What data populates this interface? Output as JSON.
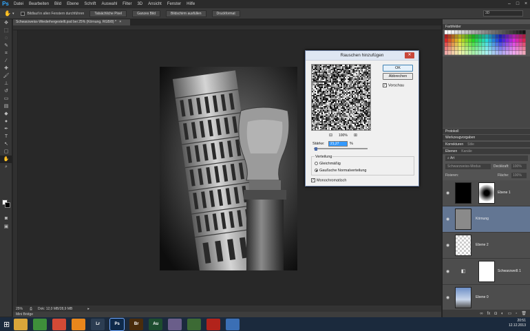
{
  "app": {
    "logo": "Ps"
  },
  "menu": [
    "Datei",
    "Bearbeiten",
    "Bild",
    "Ebene",
    "Schrift",
    "Auswahl",
    "Filter",
    "3D",
    "Ansicht",
    "Fenster",
    "Hilfe"
  ],
  "window_controls": [
    "–",
    "□",
    "×"
  ],
  "options_bar": {
    "scroll_all_label": "Bildlauf in allen Fenstern durchführen",
    "buttons": [
      "Tatsächliche Pixel",
      "Ganzes Bild",
      "Bildschirm ausfüllen",
      "Druckformat"
    ],
    "workspace": "3D"
  },
  "document": {
    "tab_title": "Schwarzweiss-Wiederhergestellt.psd bei 25% (Körnung, RGB/8) *",
    "zoom": "25%",
    "doc_size": "Dok: 12,0 MB/28,9 MB",
    "mini_bridge": "Mini Bridge"
  },
  "panels": {
    "swatches_tab": "Farbfelder",
    "protocol_tab": "Protokoll",
    "presets_tab": "Werkzeugvorgaben",
    "corrections_tabs": [
      "Korrekturen",
      "Stile"
    ],
    "layers_tabs": [
      "Ebenen",
      "Kanäle"
    ],
    "filter_kind": "Art",
    "blend_mode": "Schwarzweiss-Modus",
    "opacity_label": "Deckkraft:",
    "opacity_value": "100%",
    "lock_label": "Fixieren:",
    "fill_label": "Fläche:",
    "fill_value": "100%",
    "layers": [
      {
        "name": "Ebene 1",
        "selected": false
      },
      {
        "name": "Körnung",
        "selected": true
      },
      {
        "name": "Ebene 2",
        "selected": false
      },
      {
        "name": "Schwarzweiß 1",
        "selected": false
      },
      {
        "name": "Ebene 0",
        "selected": false
      }
    ]
  },
  "dialog": {
    "title": "Rauschen hinzufügen",
    "ok": "OK",
    "cancel": "Abbrechen",
    "preview_label": "Vorschau",
    "zoom_value": "100%",
    "amount_label": "Stärke:",
    "amount_value": "21,27",
    "amount_unit": "%",
    "distribution_label": "Verteilung",
    "uniform_label": "Gleichmäßig",
    "gaussian_label": "Gaußsche Normalverteilung",
    "mono_label": "Monochromatisch",
    "distribution": "gaussian",
    "preview_checked": true,
    "mono_checked": true
  },
  "taskbar": {
    "icons": [
      {
        "name": "explorer",
        "label": "",
        "color": "#d9a53a"
      },
      {
        "name": "app-green",
        "label": "",
        "color": "#3e8f3a"
      },
      {
        "name": "chrome",
        "label": "",
        "color": "#d34a36"
      },
      {
        "name": "vlc",
        "label": "",
        "color": "#e8861c"
      },
      {
        "name": "lightroom",
        "label": "Lr",
        "color": "#2c3d52"
      },
      {
        "name": "photoshop",
        "label": "Ps",
        "color": "#0f2a4a"
      },
      {
        "name": "bridge",
        "label": "Br",
        "color": "#4a2c0c"
      },
      {
        "name": "audition",
        "label": "Au",
        "color": "#1d4d2f"
      },
      {
        "name": "app-people",
        "label": "",
        "color": "#6a5e8a"
      },
      {
        "name": "app-frog",
        "label": "",
        "color": "#3c6a34"
      },
      {
        "name": "filezilla",
        "label": "",
        "color": "#b2231b"
      },
      {
        "name": "app-globe",
        "label": "",
        "color": "#3b6fb5"
      }
    ],
    "time": "20:51",
    "date": "12.12.2013"
  }
}
